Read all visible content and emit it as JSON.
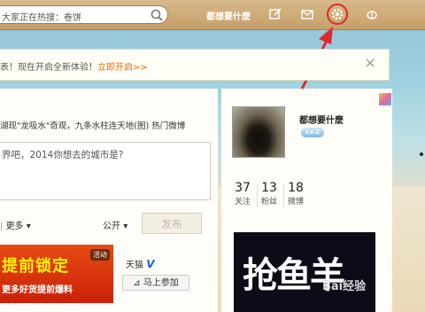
{
  "topbar": {
    "search_text": "大家正在热搜：卷饼",
    "nickname": "都想要什麽",
    "icons": [
      "search-icon",
      "edit-icon",
      "mail-icon",
      "gear-icon",
      "weibo-logo-icon"
    ]
  },
  "notice": {
    "text": "表！现在开启全新体验！",
    "link": "立即开启>>"
  },
  "feed": {
    "hot_text": "湖现\"龙吸水\"奇观，九条水柱连天地(图)",
    "hot_link": "热门微博",
    "placeholder": "界吧，2014你想去的城市是?",
    "more_label": "更多",
    "visibility_label": "公开",
    "send_label": "发布"
  },
  "ad": {
    "big": "提前锁定",
    "small": "更多好货提前爆料",
    "tag": "活动",
    "brand": "天猫",
    "join_label": "马上参加"
  },
  "profile": {
    "name": "都想要什麽",
    "level": "Lv.2",
    "stats": [
      {
        "value": "37",
        "label": "关注"
      },
      {
        "value": "13",
        "label": "粉丝"
      },
      {
        "value": "18",
        "label": "微博"
      }
    ]
  },
  "banner_text": "抢鱼羊",
  "watermark": "Bai经验"
}
